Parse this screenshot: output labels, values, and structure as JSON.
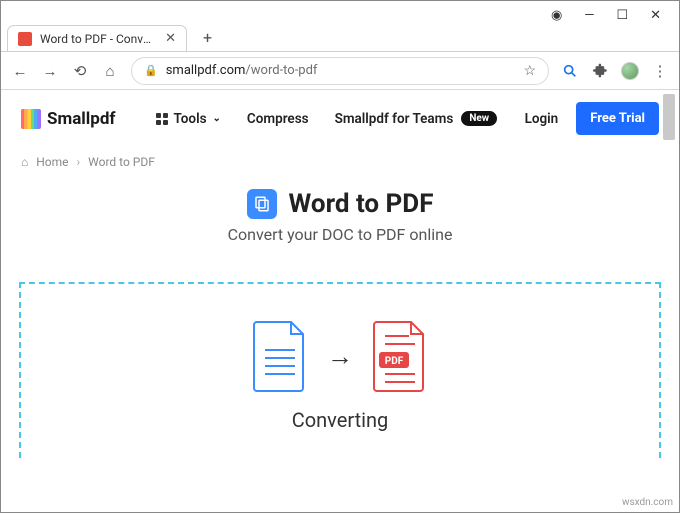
{
  "window": {
    "tab_title": "Word to PDF - Convert your DOC…"
  },
  "address_bar": {
    "host": "smallpdf.com",
    "path": "/word-to-pdf"
  },
  "site": {
    "brand": "Smallpdf",
    "nav": {
      "tools": "Tools",
      "compress": "Compress",
      "teams": "Smallpdf for Teams",
      "badge_new": "New"
    },
    "login": "Login",
    "free_trial": "Free Trial"
  },
  "breadcrumb": {
    "home": "Home",
    "current": "Word to PDF"
  },
  "hero": {
    "title": "Word to PDF",
    "subtitle": "Convert your DOC to PDF online"
  },
  "converter": {
    "pdf_badge": "PDF",
    "status": "Converting"
  },
  "watermark": "wsxdn.com"
}
